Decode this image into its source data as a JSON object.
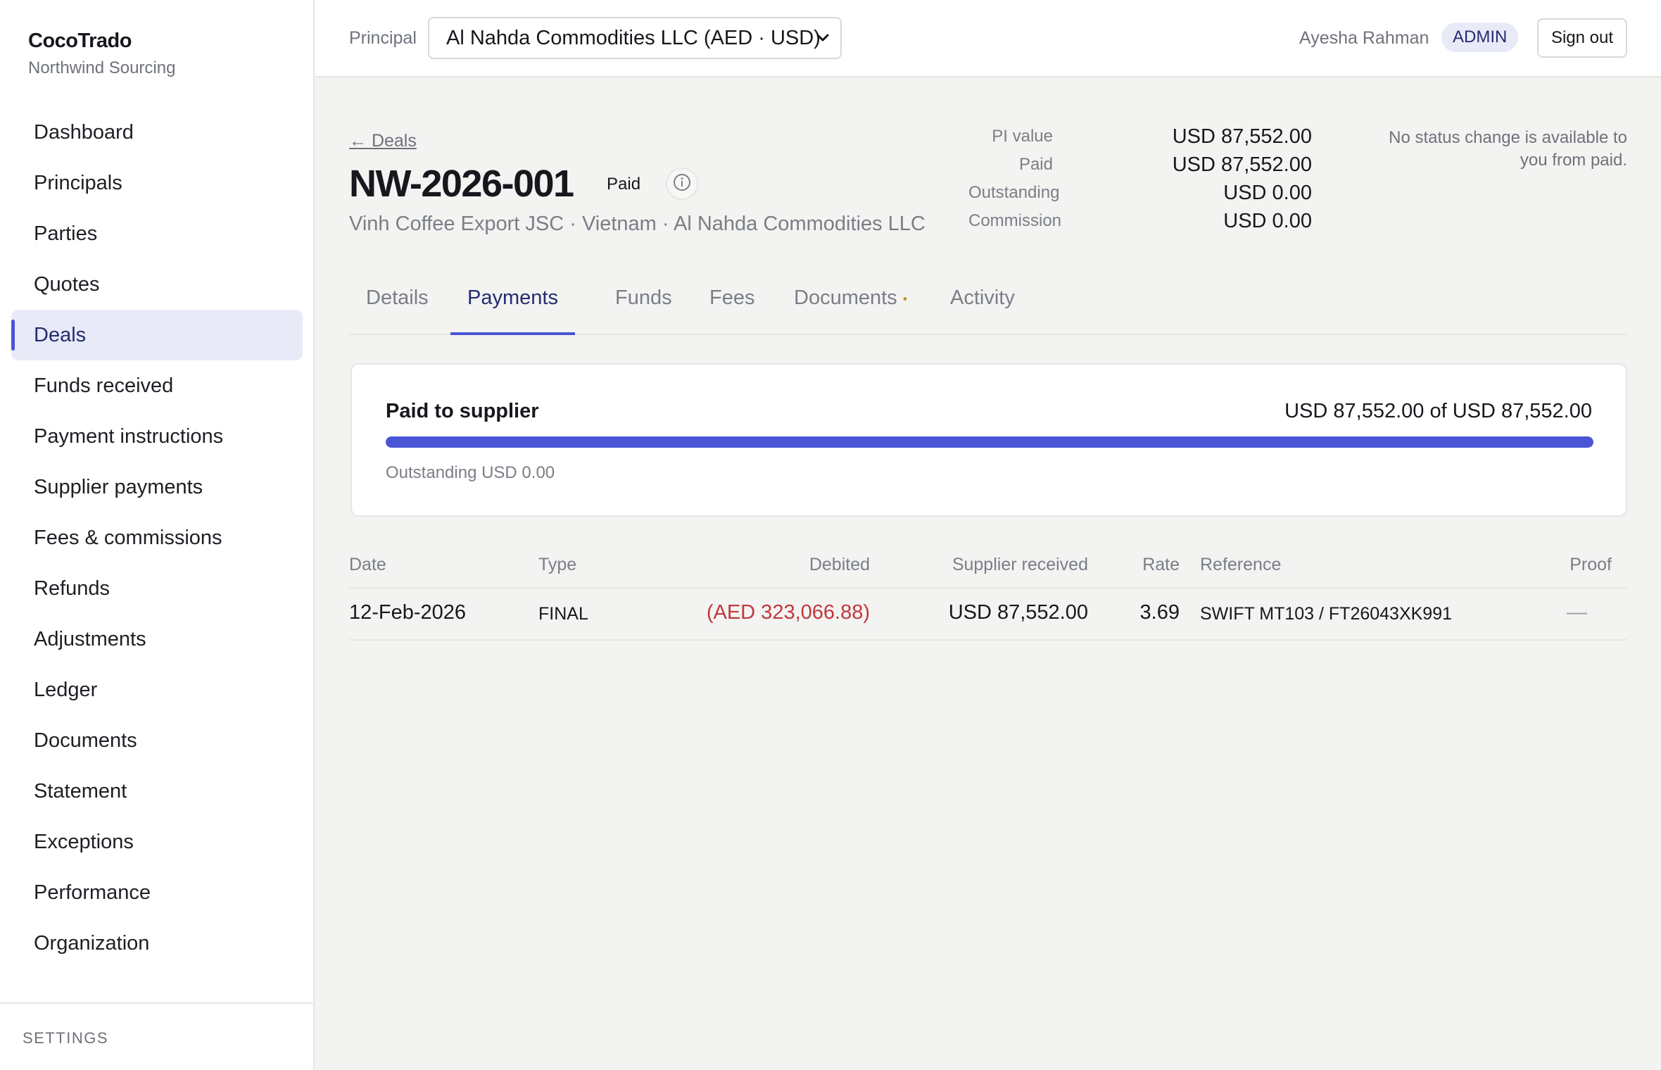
{
  "app": {
    "brand_name": "CocoTrado",
    "brand_sub": "Northwind Sourcing"
  },
  "sidebar": {
    "items": [
      {
        "label": "Dashboard"
      },
      {
        "label": "Principals"
      },
      {
        "label": "Parties"
      },
      {
        "label": "Quotes"
      },
      {
        "label": "Deals",
        "active": true
      },
      {
        "label": "Funds received"
      },
      {
        "label": "Payment instructions"
      },
      {
        "label": "Supplier payments"
      },
      {
        "label": "Fees & commissions"
      },
      {
        "label": "Refunds"
      },
      {
        "label": "Adjustments"
      },
      {
        "label": "Ledger"
      },
      {
        "label": "Documents"
      },
      {
        "label": "Statement"
      },
      {
        "label": "Exceptions"
      },
      {
        "label": "Performance"
      },
      {
        "label": "Organization"
      }
    ],
    "settings_label": "SETTINGS"
  },
  "topbar": {
    "principal_label": "Principal",
    "principal_value": "Al Nahda Commodities LLC (AED · USD)",
    "user_name": "Ayesha Rahman",
    "role": "ADMIN",
    "signout_label": "Sign out"
  },
  "deal": {
    "back_label": "← Deals",
    "title": "NW-2026-001",
    "status": "Paid",
    "parties": "Vinh Coffee Export JSC · Vietnam · Al Nahda Commodities LLC",
    "summary": {
      "pi_value_label": "PI value",
      "pi_value": "USD 87,552.00",
      "paid_label": "Paid",
      "paid": "USD 87,552.00",
      "outstanding_label": "Outstanding",
      "outstanding": "USD 0.00",
      "commission_label": "Commission",
      "commission": "USD 0.00"
    },
    "status_note": "No status change is available to you from paid."
  },
  "tabs": [
    {
      "label": "Details"
    },
    {
      "label": "Payments",
      "active": true
    },
    {
      "label": "Funds"
    },
    {
      "label": "Fees"
    },
    {
      "label": "Documents",
      "indicator": "•"
    },
    {
      "label": "Activity"
    }
  ],
  "progress": {
    "title": "Paid to supplier",
    "amount_text": "USD 87,552.00 of USD 87,552.00",
    "fraction": 1.0,
    "outstanding_text": "Outstanding USD 0.00",
    "bar_color": "#4a55d6"
  },
  "payments_table": {
    "headers": {
      "date": "Date",
      "type": "Type",
      "debited": "Debited",
      "supplier_received": "Supplier received",
      "rate": "Rate",
      "reference": "Reference",
      "proof": "Proof"
    },
    "rows": [
      {
        "date": "12-Feb-2026",
        "type": "FINAL",
        "debited": "(AED 323,066.88)",
        "supplier_received": "USD 87,552.00",
        "rate": "3.69",
        "reference": "SWIFT MT103 / FT26043XK991",
        "proof": "—"
      }
    ]
  },
  "colors": {
    "accent": "#4a55d6",
    "accent_text": "#252c6f",
    "negative": "#c0393b"
  },
  "icons": {
    "info": "info-circle-icon",
    "select_chevron": "chevron-down-icon"
  }
}
